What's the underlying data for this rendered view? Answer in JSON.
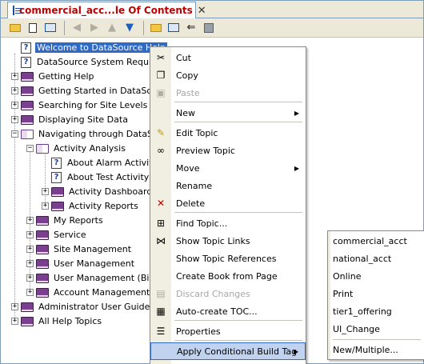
{
  "tab": {
    "title": "commercial_acc...le Of Contents",
    "close": "✕"
  },
  "toolbar": {
    "buttons": [
      "new-folder",
      "new-topic",
      "toc",
      "back",
      "forward",
      "up",
      "down",
      "folder",
      "book",
      "sync",
      "save"
    ]
  },
  "tree": {
    "items": [
      {
        "label": "Welcome to DataSource Help",
        "kind": "topic",
        "selected": true
      },
      {
        "label": "DataSource System Requirements",
        "kind": "topic"
      },
      {
        "label": "Getting Help",
        "kind": "book",
        "expand": "+"
      },
      {
        "label": "Getting Started in DataSource",
        "kind": "book",
        "expand": "+"
      },
      {
        "label": "Searching for Site Levels",
        "kind": "book",
        "expand": "+"
      },
      {
        "label": "Displaying Site Data",
        "kind": "book",
        "expand": "+"
      },
      {
        "label": "Navigating through DataSource",
        "kind": "open-book",
        "expand": "−"
      },
      {
        "label": "Activity Analysis",
        "kind": "open-book",
        "expand": "−"
      },
      {
        "label": "About Alarm Activity",
        "kind": "topic"
      },
      {
        "label": "About Test Activity",
        "kind": "topic"
      },
      {
        "label": "Activity Dashboard",
        "kind": "book",
        "expand": "+"
      },
      {
        "label": "Activity Reports",
        "kind": "book",
        "expand": "+"
      },
      {
        "label": "My Reports",
        "kind": "book",
        "expand": "+"
      },
      {
        "label": "Service",
        "kind": "book",
        "expand": "+"
      },
      {
        "label": "Site Management",
        "kind": "book",
        "expand": "+"
      },
      {
        "label": "User Management",
        "kind": "book",
        "expand": "+"
      },
      {
        "label": "User Management (Billing)",
        "kind": "book",
        "expand": "+"
      },
      {
        "label": "Account Management (Billing)",
        "kind": "book",
        "expand": "+"
      },
      {
        "label": "Administrator User Guide",
        "kind": "book",
        "expand": "+"
      },
      {
        "label": "All Help Topics",
        "kind": "book",
        "expand": "+"
      }
    ]
  },
  "context_menu": {
    "items": [
      {
        "label": "Cut",
        "icon": "scissors-icon",
        "glyph": "✂"
      },
      {
        "label": "Copy",
        "icon": "copy-icon",
        "glyph": "❐"
      },
      {
        "label": "Paste",
        "icon": "paste-icon",
        "glyph": "▣",
        "disabled": true
      },
      {
        "label": "New",
        "submenu": true
      },
      {
        "label": "Edit Topic",
        "icon": "pencil-icon",
        "glyph": "✎"
      },
      {
        "label": "Preview Topic",
        "icon": "glasses-icon",
        "glyph": "∞"
      },
      {
        "label": "Move",
        "submenu": true
      },
      {
        "label": "Rename"
      },
      {
        "label": "Delete",
        "icon": "delete-icon",
        "glyph": "✕"
      },
      {
        "label": "Find Topic...",
        "icon": "binoculars-icon",
        "glyph": "⊞"
      },
      {
        "label": "Show Topic Links",
        "icon": "links-icon",
        "glyph": "⋈"
      },
      {
        "label": "Show Topic References"
      },
      {
        "label": "Create Book from Page"
      },
      {
        "label": "Discard Changes",
        "icon": "discard-icon",
        "glyph": "▤",
        "disabled": true
      },
      {
        "label": "Auto-create TOC...",
        "icon": "toc-icon",
        "glyph": "▦"
      },
      {
        "label": "Properties",
        "icon": "properties-icon",
        "glyph": "☰"
      },
      {
        "label": "Apply Conditional Build Tag",
        "submenu": true,
        "highlighted": true
      }
    ]
  },
  "submenu": {
    "items": [
      "commercial_acct",
      "national_acct",
      "Online",
      "Print",
      "tier1_offering",
      "UI_Change"
    ],
    "extra": "New/Multiple..."
  },
  "colors": {
    "selection": "#316ac5",
    "tab_title": "#c00000",
    "highlight": "#c1d2ee"
  }
}
